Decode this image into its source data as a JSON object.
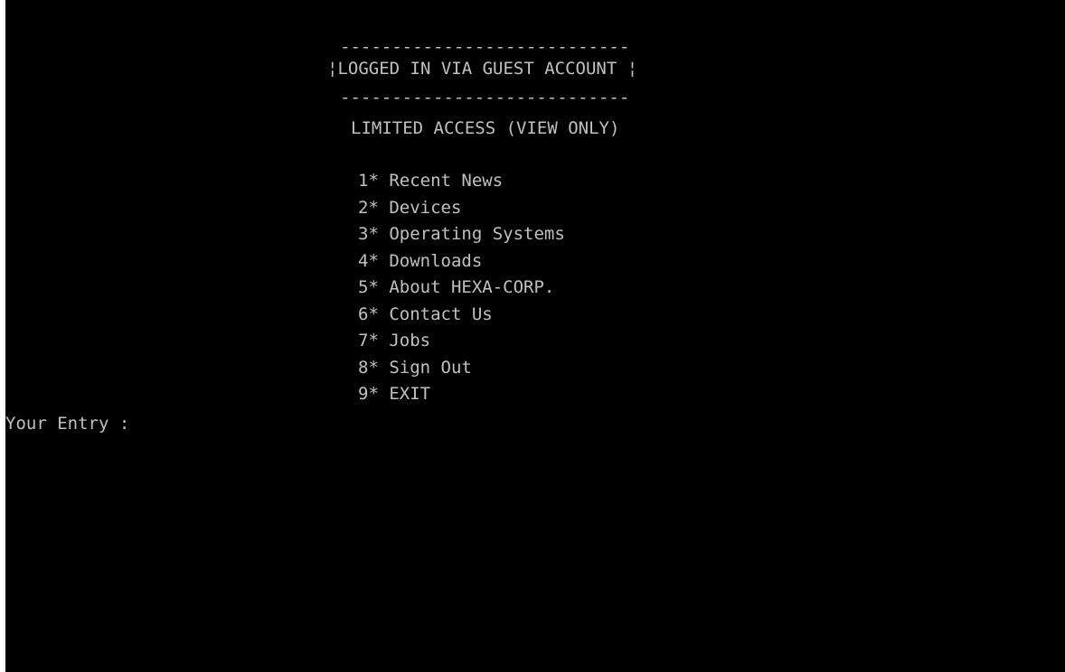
{
  "colors": {
    "background": "#000000",
    "text": "#c0c0c0"
  },
  "header": {
    "rule_top": "----------------------------",
    "banner": "¦LOGGED IN VIA GUEST ACCOUNT ¦",
    "rule_bottom": "----------------------------",
    "subtitle": "LIMITED ACCESS (VIEW ONLY)"
  },
  "menu": {
    "items": [
      {
        "number": "1*",
        "label": "Recent News"
      },
      {
        "number": "2*",
        "label": "Devices"
      },
      {
        "number": "3*",
        "label": "Operating Systems"
      },
      {
        "number": "4*",
        "label": "Downloads"
      },
      {
        "number": "5*",
        "label": "About HEXA-CORP."
      },
      {
        "number": "6*",
        "label": "Contact Us"
      },
      {
        "number": "7*",
        "label": "Jobs"
      },
      {
        "number": "8*",
        "label": "Sign Out"
      },
      {
        "number": "9*",
        "label": "EXIT"
      }
    ]
  },
  "prompt": {
    "label": "Your Entry :",
    "value": ""
  }
}
